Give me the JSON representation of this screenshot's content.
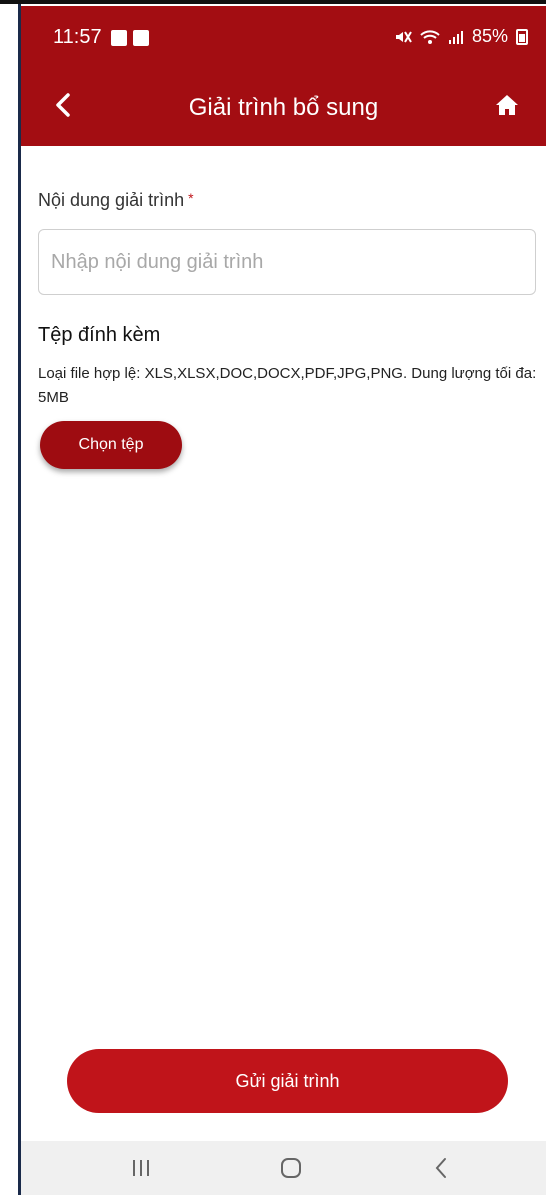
{
  "status_bar": {
    "time": "11:57",
    "battery": "85%"
  },
  "header": {
    "title": "Giải trình bổ sung",
    "back_icon": "chevron-left-icon",
    "home_icon": "home-icon"
  },
  "form": {
    "content_label": "Nội dung giải trình",
    "required_mark": "*",
    "content_placeholder": "Nhập nội dung giải trình",
    "attachment_title": "Tệp đính kèm",
    "attachment_desc": "Loại file hợp lệ: XLS,XLSX,DOC,DOCX,PDF,JPG,PNG. Dung lượng tối đa: 5MB",
    "choose_file_label": "Chọn tệp"
  },
  "footer": {
    "submit_label": "Gửi giải trình"
  },
  "system_nav": {
    "recents_icon": "recents-icon",
    "home_icon": "home-circle-icon",
    "back_icon": "back-chevron-icon"
  },
  "colors": {
    "primary": "#a30d12",
    "button": "#c0141a"
  }
}
